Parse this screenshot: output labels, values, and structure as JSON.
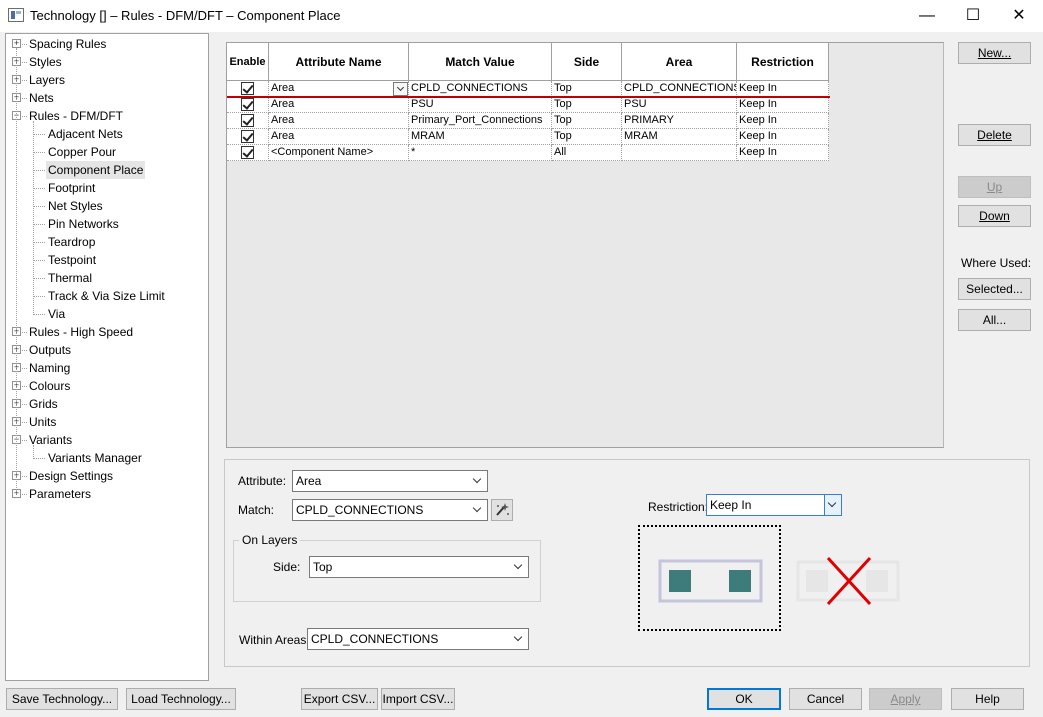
{
  "window": {
    "title": "Technology []  – Rules - DFM/DFT – Component Place",
    "minimize_glyph": "—",
    "maximize_glyph": "☐",
    "close_glyph": "✕"
  },
  "tree": [
    {
      "label": "Spacing Rules",
      "level": 0,
      "expander": "+"
    },
    {
      "label": "Styles",
      "level": 0,
      "expander": "+"
    },
    {
      "label": "Layers",
      "level": 0,
      "expander": "+"
    },
    {
      "label": "Nets",
      "level": 0,
      "expander": "+"
    },
    {
      "label": "Rules - DFM/DFT",
      "level": 0,
      "expander": "−"
    },
    {
      "label": "Adjacent Nets",
      "level": 1
    },
    {
      "label": "Copper Pour",
      "level": 1
    },
    {
      "label": "Component Place",
      "level": 1,
      "selected": true
    },
    {
      "label": "Footprint",
      "level": 1
    },
    {
      "label": "Net Styles",
      "level": 1
    },
    {
      "label": "Pin Networks",
      "level": 1
    },
    {
      "label": "Teardrop",
      "level": 1
    },
    {
      "label": "Testpoint",
      "level": 1
    },
    {
      "label": "Thermal",
      "level": 1
    },
    {
      "label": "Track & Via Size Limit",
      "level": 1
    },
    {
      "label": "Via",
      "level": 1
    },
    {
      "label": "Rules - High Speed",
      "level": 0,
      "expander": "+"
    },
    {
      "label": "Outputs",
      "level": 0,
      "expander": "+"
    },
    {
      "label": "Naming",
      "level": 0,
      "expander": "+"
    },
    {
      "label": "Colours",
      "level": 0,
      "expander": "+"
    },
    {
      "label": "Grids",
      "level": 0,
      "expander": "+"
    },
    {
      "label": "Units",
      "level": 0,
      "expander": "+"
    },
    {
      "label": "Variants",
      "level": 0,
      "expander": "−"
    },
    {
      "label": "Variants Manager",
      "level": 1
    },
    {
      "label": "Design Settings",
      "level": 0,
      "expander": "+"
    },
    {
      "label": "Parameters",
      "level": 0,
      "expander": "+"
    }
  ],
  "grid": {
    "columns": [
      "Enable",
      "Attribute Name",
      "Match Value",
      "Side",
      "Area",
      "Restriction"
    ],
    "rows": [
      {
        "enabled": true,
        "attribute": "Area",
        "match": "CPLD_CONNECTIONS",
        "side": "Top",
        "area": "CPLD_CONNECTIONS",
        "restriction": "Keep In"
      },
      {
        "enabled": true,
        "attribute": "Area",
        "match": "PSU",
        "side": "Top",
        "area": "PSU",
        "restriction": "Keep In"
      },
      {
        "enabled": true,
        "attribute": "Area",
        "match": "Primary_Port_Connections",
        "side": "Top",
        "area": "PRIMARY",
        "restriction": "Keep In"
      },
      {
        "enabled": true,
        "attribute": "Area",
        "match": "MRAM",
        "side": "Top",
        "area": "MRAM",
        "restriction": "Keep In"
      },
      {
        "enabled": true,
        "attribute": "<Component Name>",
        "match": "*",
        "side": "All",
        "area": "",
        "restriction": "Keep In"
      }
    ]
  },
  "side_buttons": {
    "new": "New...",
    "delete": "Delete",
    "up": "Up",
    "down": "Down",
    "where_used": "Where Used:",
    "selected": "Selected...",
    "all": "All..."
  },
  "detail": {
    "attribute_label": "Attribute:",
    "attribute_value": "Area",
    "match_label": "Match:",
    "match_value": "CPLD_CONNECTIONS",
    "match_picker_icon": "pick-wand-icon",
    "on_layers_title": "On Layers",
    "side_label": "Side:",
    "side_value": "Top",
    "within_areas_label": "Within Areas:",
    "within_areas_value": "CPLD_CONNECTIONS",
    "restriction_label": "Restriction:",
    "restriction_value": "Keep In",
    "preview_fill_color": "#3e7c7c",
    "preview_border_color": "#c4c4dc",
    "preview_x_color": "#e00000"
  },
  "bottom": {
    "save_tech": "Save Technology...",
    "load_tech": "Load Technology...",
    "export_csv": "Export CSV...",
    "import_csv": "Import CSV...",
    "ok": "OK",
    "cancel": "Cancel",
    "apply": "Apply",
    "help": "Help"
  }
}
